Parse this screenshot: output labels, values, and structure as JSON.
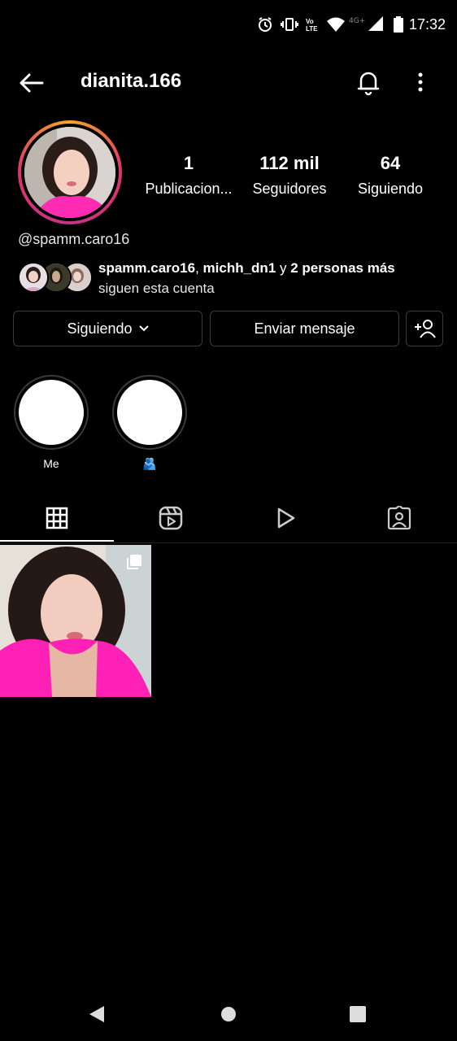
{
  "status_bar": {
    "time": "17:32",
    "icons": [
      "alarm-icon",
      "vibrate-icon",
      "volte-icon",
      "wifi-icon",
      "signal-4g-icon",
      "battery-icon"
    ]
  },
  "header": {
    "username": "dianita.166",
    "icons": [
      "back-arrow-icon",
      "bell-icon",
      "more-vertical-icon"
    ]
  },
  "profile": {
    "stats": [
      {
        "value": "1",
        "label": "Publicacion..."
      },
      {
        "value": "112 mil",
        "label": "Seguidores"
      },
      {
        "value": "64",
        "label": "Siguiendo"
      }
    ],
    "bio_handle": "@spamm.caro16",
    "followed_by": {
      "user1": "spamm.caro16",
      "sep": ", ",
      "user2": "michh_dn1",
      "and": " y ",
      "others": "2 personas más",
      "line2": "siguen esta cuenta"
    }
  },
  "actions": {
    "following_label": "Siguiendo",
    "message_label": "Enviar mensaje",
    "icons": [
      "chevron-down-icon",
      "add-person-icon"
    ]
  },
  "highlights": [
    {
      "label": "Me"
    },
    {
      "label": "🫂"
    }
  ],
  "tabs": [
    "grid-icon",
    "reels-icon",
    "video-play-icon",
    "tagged-icon"
  ],
  "posts": [
    {
      "type": "carousel",
      "icon": "multiple-photos-icon"
    }
  ],
  "nav_bar": [
    "back-triangle-icon",
    "home-circle-icon",
    "recents-square-icon"
  ],
  "colors": {
    "background": "#000000",
    "text": "#ffffff",
    "border": "#3a3a3a",
    "ring_gradient": [
      "#f5a623",
      "#e1306c",
      "#c13584"
    ]
  }
}
